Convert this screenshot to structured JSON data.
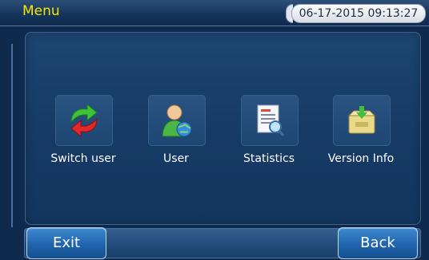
{
  "header": {
    "title": "Menu",
    "datetime": "06-17-2015 09:13:27"
  },
  "menu_items": [
    {
      "label": "Switch user",
      "icon": "switch-user-icon"
    },
    {
      "label": "User",
      "icon": "user-globe-icon"
    },
    {
      "label": "Statistics",
      "icon": "statistics-report-icon"
    },
    {
      "label": "Version Info",
      "icon": "version-info-box-icon"
    }
  ],
  "footer": {
    "exit_label": "Exit",
    "back_label": "Back"
  },
  "colors": {
    "title_text": "#f3e600",
    "screen_bg": "#0f2a4d",
    "panel_bg": "#163b66",
    "button_blue": "#1f64ad"
  }
}
